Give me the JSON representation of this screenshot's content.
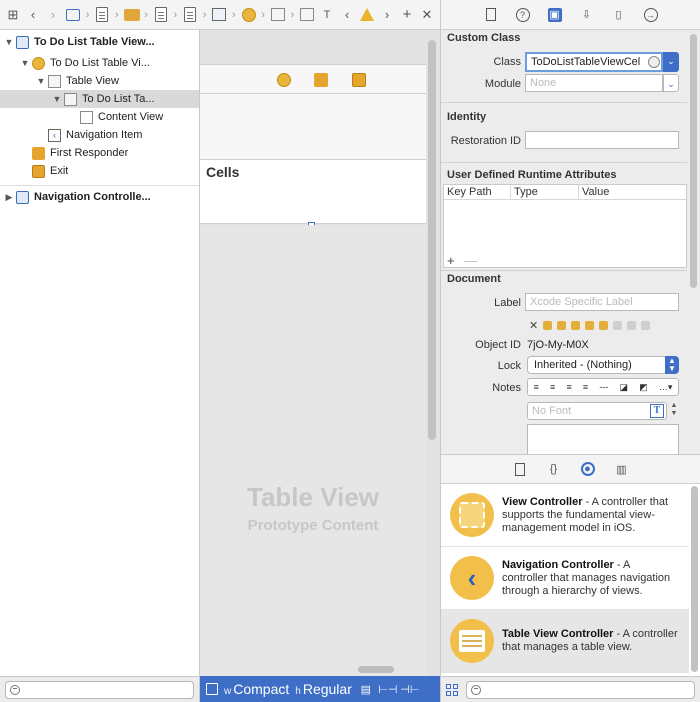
{
  "outline": {
    "items": [
      {
        "label": "To Do List Table View...",
        "bold": true
      },
      {
        "label": "To Do List Table Vi..."
      },
      {
        "label": "Table View"
      },
      {
        "label": "To Do List Ta..."
      },
      {
        "label": "Content View"
      },
      {
        "label": "Navigation Item"
      },
      {
        "label": "First Responder"
      },
      {
        "label": "Exit"
      },
      {
        "label": "Navigation Controlle...",
        "bold": true
      }
    ]
  },
  "canvas": {
    "cells_label": "Cells",
    "table_view_title": "Table View",
    "table_view_subtitle": "Prototype Content"
  },
  "size_class": {
    "width_prefix": "w",
    "width_value": "Compact",
    "height_prefix": "h",
    "height_value": "Regular"
  },
  "inspector": {
    "custom_class": {
      "title": "Custom Class",
      "class_label": "Class",
      "class_value": "ToDoListTableViewCel",
      "module_label": "Module",
      "module_placeholder": "None"
    },
    "identity": {
      "title": "Identity",
      "restoration_id_label": "Restoration ID",
      "restoration_id_value": ""
    },
    "udra": {
      "title": "User Defined Runtime Attributes",
      "columns": [
        "Key Path",
        "Type",
        "Value"
      ],
      "add": "+",
      "remove": "—"
    },
    "document": {
      "title": "Document",
      "label_label": "Label",
      "label_placeholder": "Xcode Specific Label",
      "clear": "✕",
      "object_id_label": "Object ID",
      "object_id_value": "7jO-My-M0X",
      "lock_label": "Lock",
      "lock_value": "Inherited - (Nothing)",
      "notes_label": "Notes",
      "font_placeholder": "No Font",
      "font_button": "T"
    }
  },
  "library": {
    "items": [
      {
        "name": "View Controller",
        "desc": " - A controller that supports the fundamental view-management model in iOS."
      },
      {
        "name": "Navigation Controller",
        "desc": " - A controller that manages navigation through a hierarchy of views."
      },
      {
        "name": "Table View Controller",
        "desc": " - A controller that manages a table view."
      }
    ]
  },
  "icons": {
    "accent": "#3e6ec6",
    "object": "#eab53b"
  }
}
